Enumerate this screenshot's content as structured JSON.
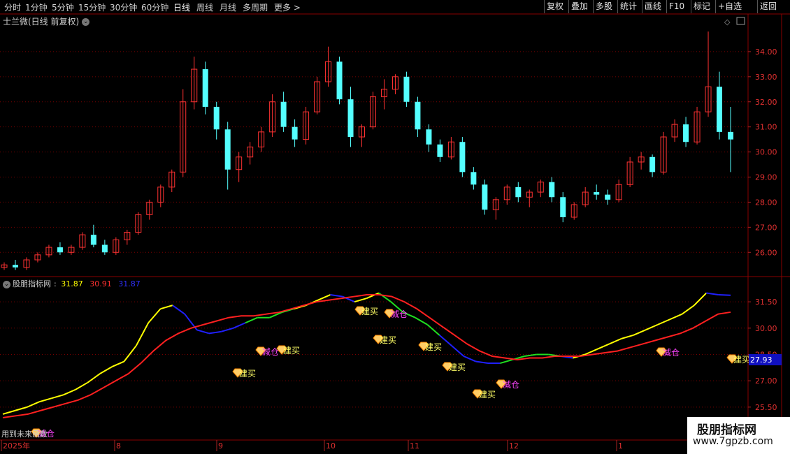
{
  "toolbar": {
    "periods": [
      "分时",
      "1分钟",
      "5分钟",
      "15分钟",
      "30分钟",
      "60分钟",
      "日线",
      "周线",
      "月线",
      "多周期",
      "更多 >"
    ],
    "active_period": "日线",
    "right_buttons": [
      "复权",
      "叠加",
      "多股",
      "统计",
      "画线",
      "F10",
      "标记",
      "+自选",
      "返回"
    ]
  },
  "main_chart": {
    "title": "士兰微(日线 前复权)",
    "price_ticks": [
      "34.00",
      "33.00",
      "32.00",
      "31.00",
      "30.00",
      "29.00",
      "28.00",
      "27.00",
      "26.00"
    ]
  },
  "indicator": {
    "name": "股朋指标网",
    "separator": ":",
    "values": [
      "31.87",
      "30.91",
      "31.87"
    ],
    "value_colors": [
      "#ffff00",
      "#ff3030",
      "#3030ff"
    ],
    "ticks": [
      "31.50",
      "30.00",
      "28.50",
      "27.00",
      "25.50"
    ],
    "last_value": "27.93",
    "signals": {
      "buy_label": "建买",
      "sell_label": "减仓"
    }
  },
  "x_axis": {
    "labels": [
      "2025年",
      "8",
      "9",
      "10",
      "11",
      "12",
      "1"
    ]
  },
  "bottom_left_text": "用到未来函数",
  "colors": {
    "up": "#ff3232",
    "down": "#54ffff",
    "grid": "#7a0000",
    "yellow": "#ffff00",
    "red": "#ff2020",
    "blue": "#2020ff",
    "green": "#20e020"
  },
  "watermark": {
    "title": "股朋指标网",
    "url": "www.7gpzb.com"
  },
  "chart_data": [
    {
      "type": "candlestick",
      "title": "士兰微(日线 前复权)",
      "ylim": [
        25.2,
        35.0
      ],
      "x": [
        "2025-07",
        "2025-08",
        "2025-09",
        "2025-10",
        "2025-11",
        "2025-12",
        "2026-01"
      ],
      "ohlc": [
        [
          25.4,
          25.6,
          25.3,
          25.5
        ],
        [
          25.5,
          25.7,
          25.3,
          25.4
        ],
        [
          25.4,
          25.8,
          25.3,
          25.7
        ],
        [
          25.7,
          26.0,
          25.6,
          25.9
        ],
        [
          25.9,
          26.3,
          25.8,
          26.2
        ],
        [
          26.2,
          26.4,
          25.9,
          26.0
        ],
        [
          26.0,
          26.3,
          25.9,
          26.2
        ],
        [
          26.2,
          26.8,
          26.1,
          26.7
        ],
        [
          26.7,
          27.1,
          26.2,
          26.3
        ],
        [
          26.3,
          26.5,
          25.9,
          26.0
        ],
        [
          26.0,
          26.6,
          25.9,
          26.5
        ],
        [
          26.5,
          26.9,
          26.3,
          26.8
        ],
        [
          26.8,
          27.6,
          26.7,
          27.5
        ],
        [
          27.5,
          28.1,
          27.3,
          28.0
        ],
        [
          28.0,
          28.7,
          27.8,
          28.6
        ],
        [
          28.6,
          29.3,
          28.4,
          29.2
        ],
        [
          29.2,
          32.5,
          29.0,
          32.0
        ],
        [
          32.0,
          33.8,
          31.7,
          33.3
        ],
        [
          33.3,
          33.6,
          31.5,
          31.8
        ],
        [
          31.8,
          32.0,
          30.5,
          30.9
        ],
        [
          30.9,
          31.2,
          28.5,
          29.3
        ],
        [
          29.3,
          30.0,
          28.8,
          29.8
        ],
        [
          29.8,
          30.4,
          29.5,
          30.2
        ],
        [
          30.2,
          31.0,
          30.0,
          30.8
        ],
        [
          30.8,
          32.3,
          30.6,
          32.0
        ],
        [
          32.0,
          32.4,
          30.8,
          31.0
        ],
        [
          31.0,
          31.3,
          30.2,
          30.5
        ],
        [
          30.5,
          31.8,
          30.3,
          31.6
        ],
        [
          31.6,
          33.0,
          31.5,
          32.8
        ],
        [
          32.8,
          34.2,
          32.6,
          33.6
        ],
        [
          33.6,
          33.8,
          31.9,
          32.1
        ],
        [
          32.1,
          32.6,
          30.2,
          30.6
        ],
        [
          30.6,
          31.1,
          30.2,
          31.0
        ],
        [
          31.0,
          32.4,
          30.9,
          32.2
        ],
        [
          32.2,
          32.9,
          31.7,
          32.5
        ],
        [
          32.5,
          33.1,
          32.3,
          33.0
        ],
        [
          33.0,
          33.2,
          31.8,
          32.0
        ],
        [
          32.0,
          32.2,
          30.6,
          30.9
        ],
        [
          30.9,
          31.1,
          30.0,
          30.3
        ],
        [
          30.3,
          30.5,
          29.6,
          29.8
        ],
        [
          29.8,
          30.6,
          29.7,
          30.4
        ],
        [
          30.4,
          30.6,
          29.0,
          29.2
        ],
        [
          29.2,
          29.4,
          28.5,
          28.7
        ],
        [
          28.7,
          28.9,
          27.5,
          27.7
        ],
        [
          27.7,
          28.2,
          27.3,
          28.1
        ],
        [
          28.1,
          28.7,
          27.9,
          28.6
        ],
        [
          28.6,
          28.8,
          28.0,
          28.2
        ],
        [
          28.2,
          28.5,
          27.8,
          28.4
        ],
        [
          28.4,
          28.9,
          28.2,
          28.8
        ],
        [
          28.8,
          29.0,
          28.0,
          28.2
        ],
        [
          28.2,
          28.4,
          27.2,
          27.4
        ],
        [
          27.4,
          28.0,
          27.3,
          27.9
        ],
        [
          27.9,
          28.6,
          27.8,
          28.4
        ],
        [
          28.4,
          28.7,
          28.1,
          28.3
        ],
        [
          28.3,
          28.5,
          27.9,
          28.1
        ],
        [
          28.1,
          28.9,
          28.0,
          28.7
        ],
        [
          28.7,
          29.8,
          28.6,
          29.6
        ],
        [
          29.6,
          30.0,
          29.3,
          29.8
        ],
        [
          29.8,
          29.9,
          29.0,
          29.2
        ],
        [
          29.2,
          30.8,
          29.1,
          30.6
        ],
        [
          30.6,
          31.3,
          30.4,
          31.1
        ],
        [
          31.1,
          31.4,
          30.2,
          30.4
        ],
        [
          30.4,
          31.8,
          30.3,
          31.6
        ],
        [
          31.6,
          34.8,
          31.4,
          32.6
        ],
        [
          32.6,
          33.2,
          30.5,
          30.8
        ],
        [
          30.8,
          31.8,
          29.2,
          30.5
        ]
      ]
    },
    {
      "type": "line",
      "title": "股朋指标网",
      "ylim": [
        24.5,
        32.3
      ],
      "series": [
        {
          "name": "31.87",
          "color": "#ffff00"
        },
        {
          "name": "30.91",
          "color": "#ff3030"
        },
        {
          "name": "31.87",
          "color": "#3030ff"
        }
      ],
      "yellow": [
        25.1,
        25.3,
        25.5,
        25.8,
        26.0,
        26.2,
        26.5,
        26.9,
        27.4,
        27.8,
        28.1,
        29.0,
        30.3,
        31.1,
        31.3,
        30.8,
        29.9,
        29.7,
        29.8,
        30.0,
        30.3,
        30.6,
        30.6,
        30.9,
        31.1,
        31.3,
        31.6,
        31.9,
        31.8,
        31.5,
        31.7,
        32.0,
        31.5,
        30.9,
        30.6,
        30.2,
        29.6,
        29.0,
        28.4,
        28.1,
        28.0,
        28.0,
        28.2,
        28.4,
        28.5,
        28.5,
        28.4,
        28.3,
        28.5,
        28.8,
        29.1,
        29.4,
        29.6,
        29.9,
        30.2,
        30.5,
        30.8,
        31.3,
        32.0,
        31.9,
        31.87
      ],
      "red": [
        24.9,
        25.0,
        25.1,
        25.3,
        25.5,
        25.7,
        25.9,
        26.2,
        26.6,
        27.0,
        27.4,
        28.0,
        28.7,
        29.3,
        29.7,
        30.0,
        30.2,
        30.4,
        30.6,
        30.7,
        30.7,
        30.8,
        30.9,
        31.1,
        31.3,
        31.5,
        31.6,
        31.7,
        31.8,
        31.9,
        31.9,
        31.8,
        31.5,
        31.1,
        30.6,
        30.1,
        29.6,
        29.1,
        28.7,
        28.4,
        28.3,
        28.2,
        28.3,
        28.3,
        28.4,
        28.4,
        28.4,
        28.5,
        28.6,
        28.7,
        28.9,
        29.1,
        29.3,
        29.5,
        29.7,
        30.0,
        30.4,
        30.8,
        30.91
      ]
    }
  ]
}
